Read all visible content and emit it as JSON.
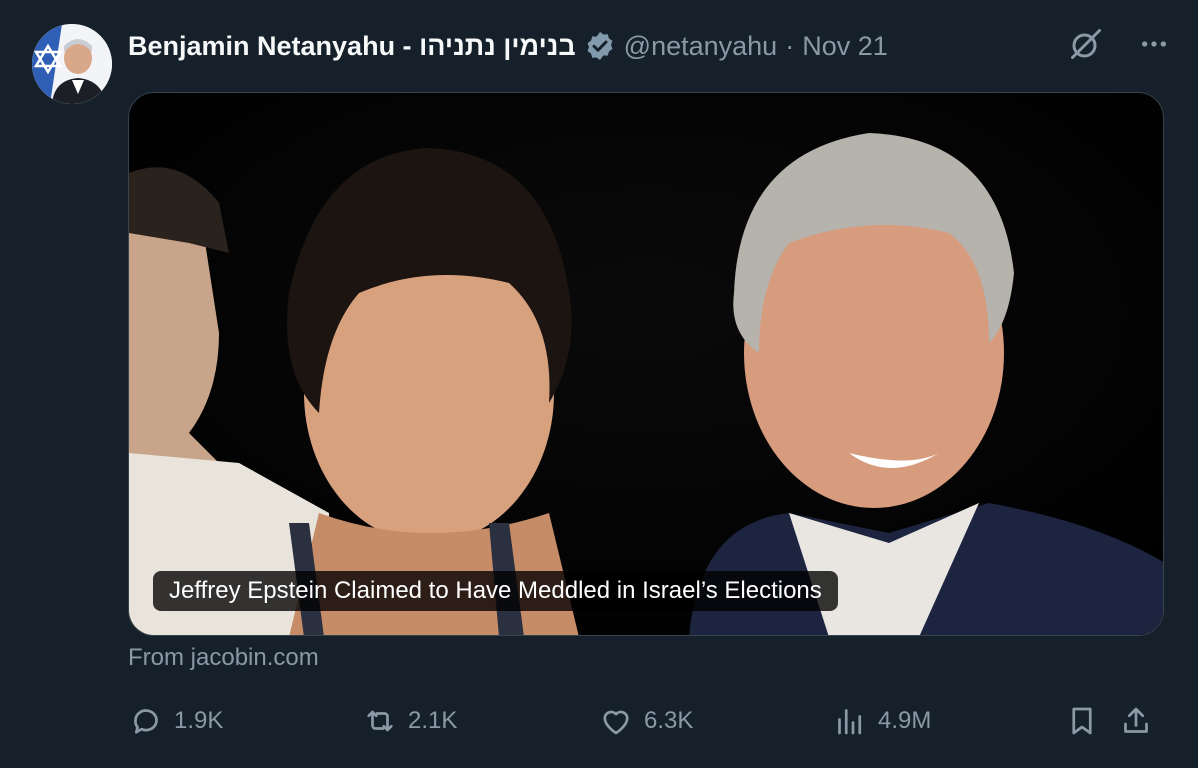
{
  "author": {
    "name": "Benjamin Netanyahu - בנימין נתניהו",
    "handle": "@netanyahu",
    "separator": "·",
    "date": "Nov 21"
  },
  "card": {
    "title": "Jeffrey Epstein Claimed to Have Meddled in Israel’s Elections",
    "source": "From jacobin.com"
  },
  "stats": {
    "replies": "1.9K",
    "reposts": "2.1K",
    "likes": "6.3K",
    "views": "4.9M"
  },
  "icons": {
    "verified": "verified-badge-icon",
    "grok": "grok-icon",
    "more": "more-icon",
    "reply": "reply-icon",
    "repost": "repost-icon",
    "like": "heart-icon",
    "views": "views-icon",
    "bookmark": "bookmark-icon",
    "share": "share-icon"
  },
  "colors": {
    "background": "#15202b",
    "secondary_text": "#8b98a5",
    "primary_text": "#f7f9f9",
    "border": "#38444d"
  }
}
